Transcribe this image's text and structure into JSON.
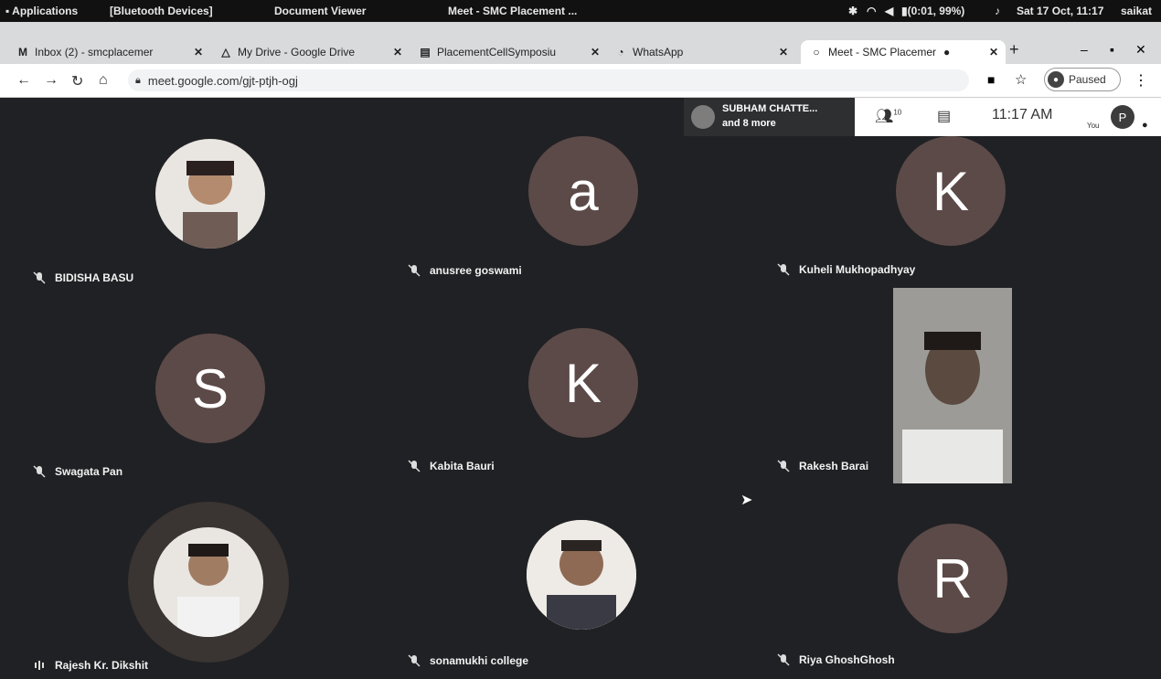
{
  "os_bar": {
    "applications": "Applications",
    "bluetooth": "[Bluetooth Devices]",
    "document_viewer": "Document Viewer",
    "meet_window": "Meet - SMC Placement ...",
    "battery": "(0:01, 99%)",
    "datetime": "Sat 17 Oct, 11:17",
    "user": "saikat"
  },
  "tabs": [
    {
      "label": "Inbox (2) - smcplacemer",
      "icon": "gmail-icon"
    },
    {
      "label": "My Drive - Google Drive",
      "icon": "drive-icon"
    },
    {
      "label": "PlacementCellSymposiu",
      "icon": "forms-icon"
    },
    {
      "label": "WhatsApp",
      "icon": "whatsapp-icon"
    },
    {
      "label": "Meet - SMC Placemer",
      "icon": "meet-icon"
    }
  ],
  "address_bar": {
    "url": "meet.google.com/gjt-ptjh-ogj",
    "paused_label": "Paused"
  },
  "meeting": {
    "presenter_name": "SUBHAM CHATTE...",
    "presenter_more": "and 8 more",
    "time": "11:17 AM",
    "you_label": "You",
    "self_initial": "P",
    "people_count": "10"
  },
  "participants": [
    {
      "name": "BIDISHA BASU",
      "initial": "",
      "type": "photo"
    },
    {
      "name": "anusree goswami",
      "initial": "a",
      "type": "letter"
    },
    {
      "name": "Kuheli Mukhopadhyay",
      "initial": "K",
      "type": "letter"
    },
    {
      "name": "Swagata Pan",
      "initial": "S",
      "type": "letter"
    },
    {
      "name": "Kabita Bauri",
      "initial": "K",
      "type": "letter"
    },
    {
      "name": "Rakesh Barai",
      "initial": "",
      "type": "video"
    },
    {
      "name": "Rajesh Kr. Dikshit",
      "initial": "",
      "type": "photo"
    },
    {
      "name": "sonamukhi college",
      "initial": "",
      "type": "photo"
    },
    {
      "name": "Riya GhoshGhosh",
      "initial": "R",
      "type": "letter"
    }
  ],
  "colors": {
    "meet_bg": "#202124",
    "avatar_bg": "#5c4a48"
  }
}
